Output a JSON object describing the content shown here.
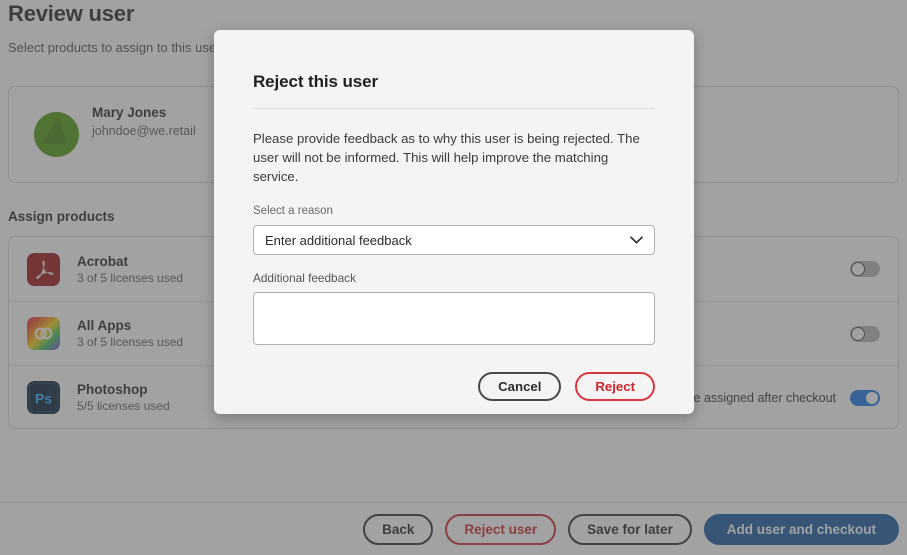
{
  "page": {
    "title": "Review user",
    "subtitle": "Select products to assign to this user",
    "user": {
      "name": "Mary Jones",
      "email": "johndoe@we.retail",
      "avatar_icon": "user-avatar-green-circle"
    },
    "assign_products_heading": "Assign products",
    "products": [
      {
        "name": "Acrobat",
        "licenses": "3 of 5 licenses used",
        "icon": "acrobat-icon",
        "note": "",
        "toggle_on": false
      },
      {
        "name": "All Apps",
        "licenses": "3 of 5 licenses used",
        "icon": "all-apps-icon",
        "note": "",
        "toggle_on": false
      },
      {
        "name": "Photoshop",
        "licenses": "5/5 licenses used",
        "icon": "photoshop-icon",
        "note": "ill be assigned after checkout",
        "toggle_on": true
      }
    ],
    "footer_buttons": {
      "back": "Back",
      "reject_user": "Reject user",
      "save_for_later": "Save for later",
      "add_user_and_checkout": "Add user and checkout"
    }
  },
  "dialog": {
    "title": "Reject this user",
    "body": "Please provide feedback as to why this user is being rejected. The user will not be informed. This will help improve the matching service.",
    "reason_label": "Select a reason",
    "reason_value": "Enter additional feedback",
    "reason_options": [
      "Enter additional feedback"
    ],
    "feedback_label": "Additional feedback",
    "feedback_value": "",
    "feedback_placeholder": "",
    "cancel_label": "Cancel",
    "reject_label": "Reject",
    "chevron_icon": "chevron-down-icon"
  },
  "colors": {
    "danger": "#c9252d",
    "cta_blue": "#1257a0",
    "toggle_on": "#1473e6",
    "avatar_green": "#4c9a0f",
    "dialog_bg": "#f4f4f4",
    "overlay": "rgba(86,86,86,0.55)"
  }
}
